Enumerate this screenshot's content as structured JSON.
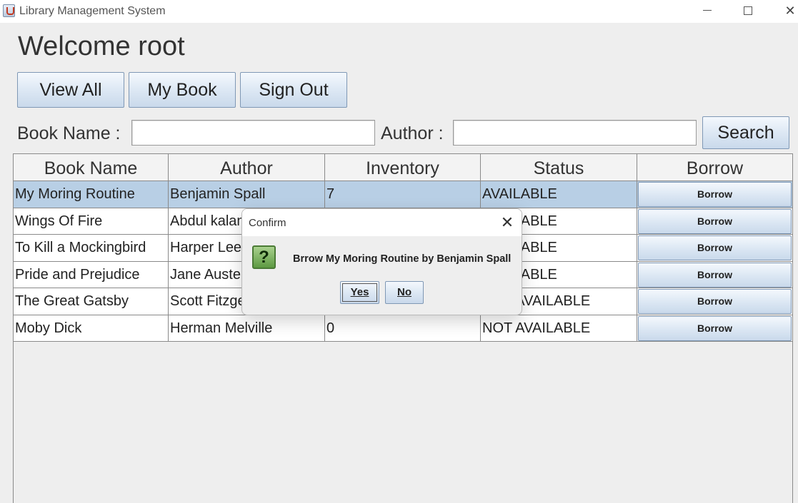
{
  "window": {
    "title": "Library Management System",
    "minimize": "—",
    "maximize": "☐",
    "close": "✕"
  },
  "header": {
    "welcome": "Welcome root"
  },
  "nav": {
    "view_all": "View All",
    "my_book": "My Book",
    "sign_out": "Sign Out"
  },
  "search": {
    "book_name_label": "Book Name :",
    "book_name_value": "",
    "author_label": "Author :",
    "author_value": "",
    "search_button": "Search"
  },
  "table": {
    "headers": [
      "Book Name",
      "Author",
      "Inventory",
      "Status",
      "Borrow"
    ],
    "rows": [
      {
        "book": "My Moring Routine",
        "author": "Benjamin Spall",
        "inventory": "7",
        "status": "AVAILABLE",
        "action": "Borrow"
      },
      {
        "book": "Wings Of Fire",
        "author": "Abdul kalam",
        "inventory": "",
        "status": "AVAILABLE",
        "action": "Borrow"
      },
      {
        "book": "To Kill a Mockingbird",
        "author": "Harper Lee",
        "inventory": "",
        "status": "AVAILABLE",
        "action": "Borrow"
      },
      {
        "book": "Pride and Prejudice",
        "author": "Jane Austen",
        "inventory": "",
        "status": "AVAILABLE",
        "action": "Borrow"
      },
      {
        "book": "The Great Gatsby",
        "author": "Scott Fitzgerald",
        "inventory": "",
        "status": "NOT AVAILABLE",
        "action": "Borrow"
      },
      {
        "book": "Moby Dick",
        "author": "Herman Melville",
        "inventory": "0",
        "status": "NOT AVAILABLE",
        "action": "Borrow"
      }
    ],
    "selected_row": 0
  },
  "dialog": {
    "title": "Confirm",
    "close": "✕",
    "icon": "question-icon",
    "icon_glyph": "?",
    "message": "Brrow My Moring Routine by Benjamin Spall",
    "yes": "Yes",
    "no": "No"
  }
}
